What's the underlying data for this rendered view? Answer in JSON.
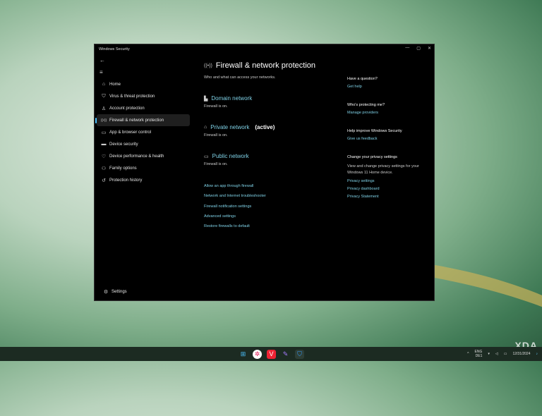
{
  "window": {
    "title": "Windows Security",
    "controls": [
      "—",
      "▢",
      "✕"
    ]
  },
  "nav": {
    "back": "←",
    "menu": "≡",
    "items": [
      {
        "label": "Home",
        "icon": "⌂"
      },
      {
        "label": "Virus & threat protection",
        "icon": "⛉"
      },
      {
        "label": "Account protection",
        "icon": "♙"
      },
      {
        "label": "Firewall & network protection",
        "icon": "((•))"
      },
      {
        "label": "App & browser control",
        "icon": "▭"
      },
      {
        "label": "Device security",
        "icon": "▬"
      },
      {
        "label": "Device performance & health",
        "icon": "♡"
      },
      {
        "label": "Family options",
        "icon": "⚇"
      },
      {
        "label": "Protection history",
        "icon": "↺"
      }
    ],
    "settings": {
      "label": "Settings",
      "icon": "⚙"
    }
  },
  "main": {
    "title": "Firewall & network protection",
    "subtitle": "Who and what can access your networks.",
    "networks": [
      {
        "name": "Domain network",
        "status": "Firewall is on.",
        "active": ""
      },
      {
        "name": "Private network",
        "status": "Firewall is on.",
        "active": "(active)"
      },
      {
        "name": "Public network",
        "status": "Firewall is on.",
        "active": ""
      }
    ],
    "links": [
      "Allow an app through firewall",
      "Network and Internet troubleshooter",
      "Firewall notification settings",
      "Advanced settings",
      "Restore firewalls to default"
    ]
  },
  "side": {
    "question": {
      "title": "Have a question?",
      "link": "Get help"
    },
    "protecting": {
      "title": "Who's protecting me?",
      "link": "Manage providers"
    },
    "improve": {
      "title": "Help improve Windows Security",
      "link": "Give us feedback"
    },
    "privacy": {
      "title": "Change your privacy settings",
      "text": "View and change privacy settings for your Windows 11 Home device.",
      "links": [
        "Privacy settings",
        "Privacy dashboard",
        "Privacy Statement"
      ]
    }
  },
  "taskbar": {
    "lang": "ENG",
    "region": "DE1",
    "date": "12/31/2024",
    "watermark": "XDA"
  }
}
